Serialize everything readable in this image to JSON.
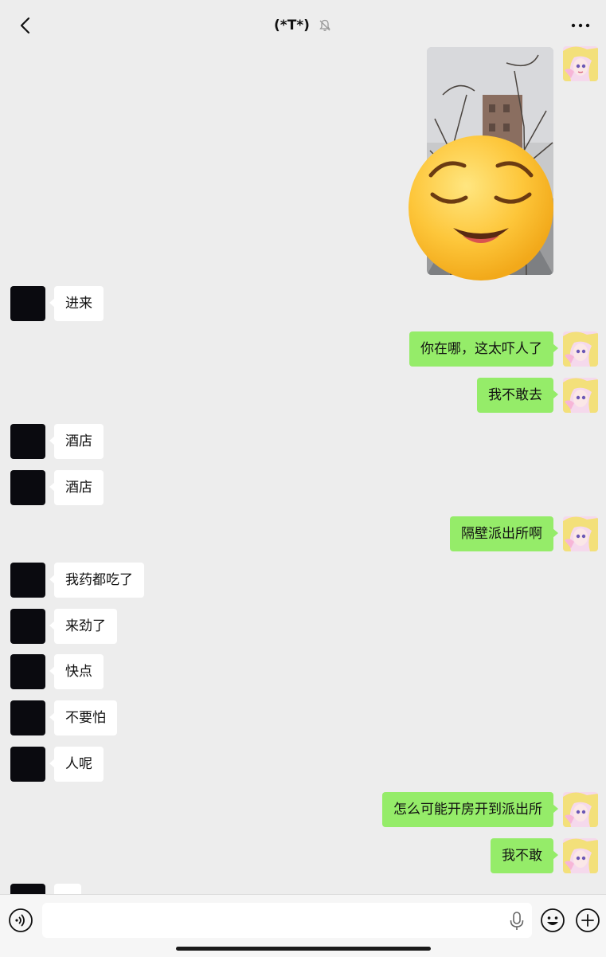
{
  "header": {
    "title": "(*T*)",
    "back_icon": "chevron-left-icon",
    "mute_icon": "bell-off-icon",
    "more_icon": "ellipsis-icon"
  },
  "messages": [
    {
      "side": "right",
      "type": "image"
    },
    {
      "side": "left",
      "text": "进来"
    },
    {
      "side": "right",
      "text": "你在哪，这太吓人了"
    },
    {
      "side": "right",
      "text": "我不敢去"
    },
    {
      "side": "left",
      "text": "酒店"
    },
    {
      "side": "left",
      "text": "酒店"
    },
    {
      "side": "right",
      "text": "隔壁派出所啊"
    },
    {
      "side": "left",
      "text": "我药都吃了"
    },
    {
      "side": "left",
      "text": "来劲了"
    },
    {
      "side": "left",
      "text": "快点"
    },
    {
      "side": "left",
      "text": "不要怕"
    },
    {
      "side": "left",
      "text": "人呢"
    },
    {
      "side": "right",
      "text": "怎么可能开房开到派出所"
    },
    {
      "side": "right",
      "text": "我不敢"
    }
  ],
  "input_bar": {
    "value": "",
    "voice_icon": "voice-icon",
    "mic_icon": "mic-icon",
    "emoji_icon": "smiley-icon",
    "plus_icon": "plus-icon"
  },
  "colors": {
    "background": "#ededed",
    "sent_bubble": "#95ec69",
    "received_bubble": "#ffffff"
  }
}
